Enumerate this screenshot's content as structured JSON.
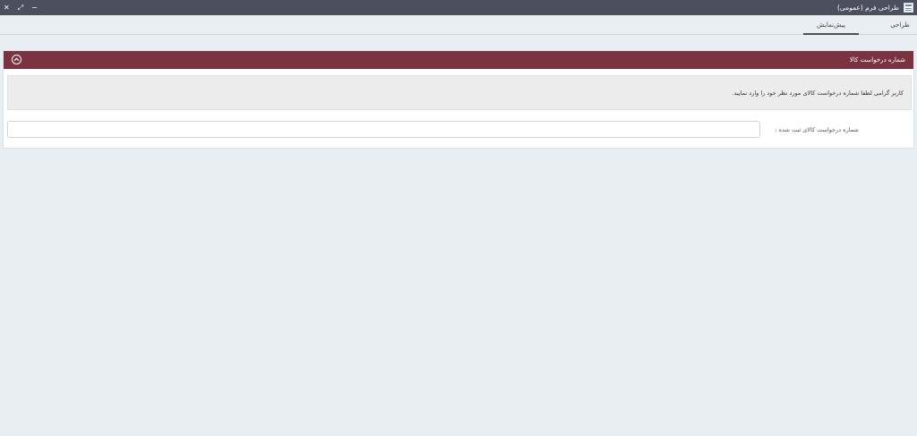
{
  "window": {
    "title": "طراحی فرم (عمومی)",
    "controls": {
      "close": "✕",
      "maximize": "⤢",
      "minimize": "−"
    }
  },
  "tabs": [
    {
      "label": "طراحی",
      "active": false
    },
    {
      "label": "پیش‌نمایش",
      "active": true
    }
  ],
  "panel": {
    "title": "شماره درخواست کالا",
    "notice": "کاربر گرامی لطفا شماره درخواست کالای مورد نظر خود را وارد نمایید.",
    "field": {
      "label": "شماره درخواست کالای ثبت شده :",
      "value": "",
      "placeholder": ""
    }
  },
  "colors": {
    "titlebar": "#4b4f5e",
    "panel_header": "#7a3441",
    "background": "#e9eef3"
  },
  "icons": {
    "app": "form-designer-icon",
    "collapse": "chevron-up-circle-icon"
  }
}
